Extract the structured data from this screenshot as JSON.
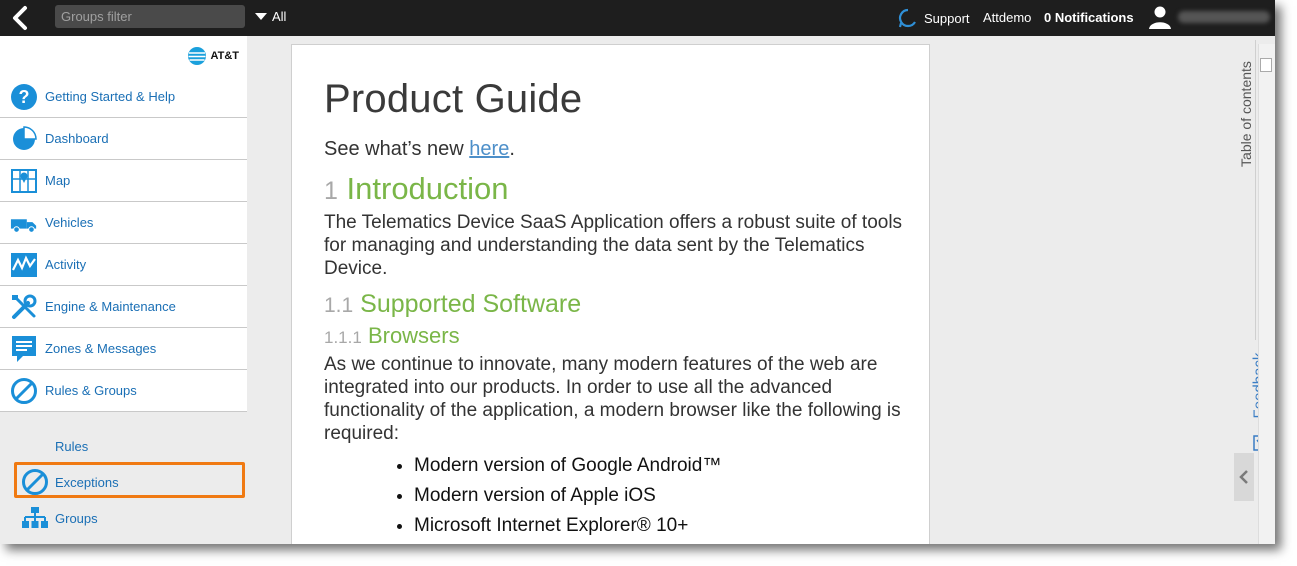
{
  "topbar": {
    "groups_filter_placeholder": "Groups filter",
    "all_label": "All",
    "support_label": "Support",
    "account_label": "Attdemo",
    "notifications_label": "0 Notifications"
  },
  "brand": {
    "name": "AT&T"
  },
  "sidebar": {
    "items": [
      {
        "label": "Getting Started & Help",
        "icon": "help-icon"
      },
      {
        "label": "Dashboard",
        "icon": "pie-chart-icon"
      },
      {
        "label": "Map",
        "icon": "map-icon"
      },
      {
        "label": "Vehicles",
        "icon": "truck-icon"
      },
      {
        "label": "Activity",
        "icon": "activity-icon"
      },
      {
        "label": "Engine & Maintenance",
        "icon": "wrench-icon"
      },
      {
        "label": "Zones & Messages",
        "icon": "message-icon"
      },
      {
        "label": "Rules & Groups",
        "icon": "no-entry-icon"
      }
    ],
    "sub_items": [
      {
        "label": "Rules"
      },
      {
        "label": "Exceptions",
        "icon": "no-entry-icon"
      },
      {
        "label": "Groups",
        "icon": "org-chart-icon"
      }
    ],
    "highlight_color": "#f07a12"
  },
  "document": {
    "title": "Product Guide",
    "whats_new_prefix": "See what’s new ",
    "whats_new_link": "here",
    "whats_new_suffix": ".",
    "sec1_num": "1",
    "sec1_title": "Introduction",
    "sec1_body": "The Telematics Device SaaS Application offers a robust suite of tools for managing and understanding the data sent by the Telematics Device.",
    "sec11_num": "1.1",
    "sec11_title": "Supported Software",
    "sec111_num": "1.1.1",
    "sec111_title": "Browsers",
    "sec111_body": "As we continue to innovate, many modern features of the web are integrated into our products. In order to use all the advanced functionality of the application, a modern browser like the following is required:",
    "bullets": [
      "Modern version of Google Android™",
      "Modern version of Apple iOS",
      "Microsoft Internet Explorer® 10+"
    ]
  },
  "right_panel": {
    "toc_label": "Table of contents",
    "feedback_label": "Feedback"
  },
  "colors": {
    "link_blue": "#1a6fb5",
    "heading_green": "#7ab648",
    "topbar_bg": "#1e1e1e"
  }
}
